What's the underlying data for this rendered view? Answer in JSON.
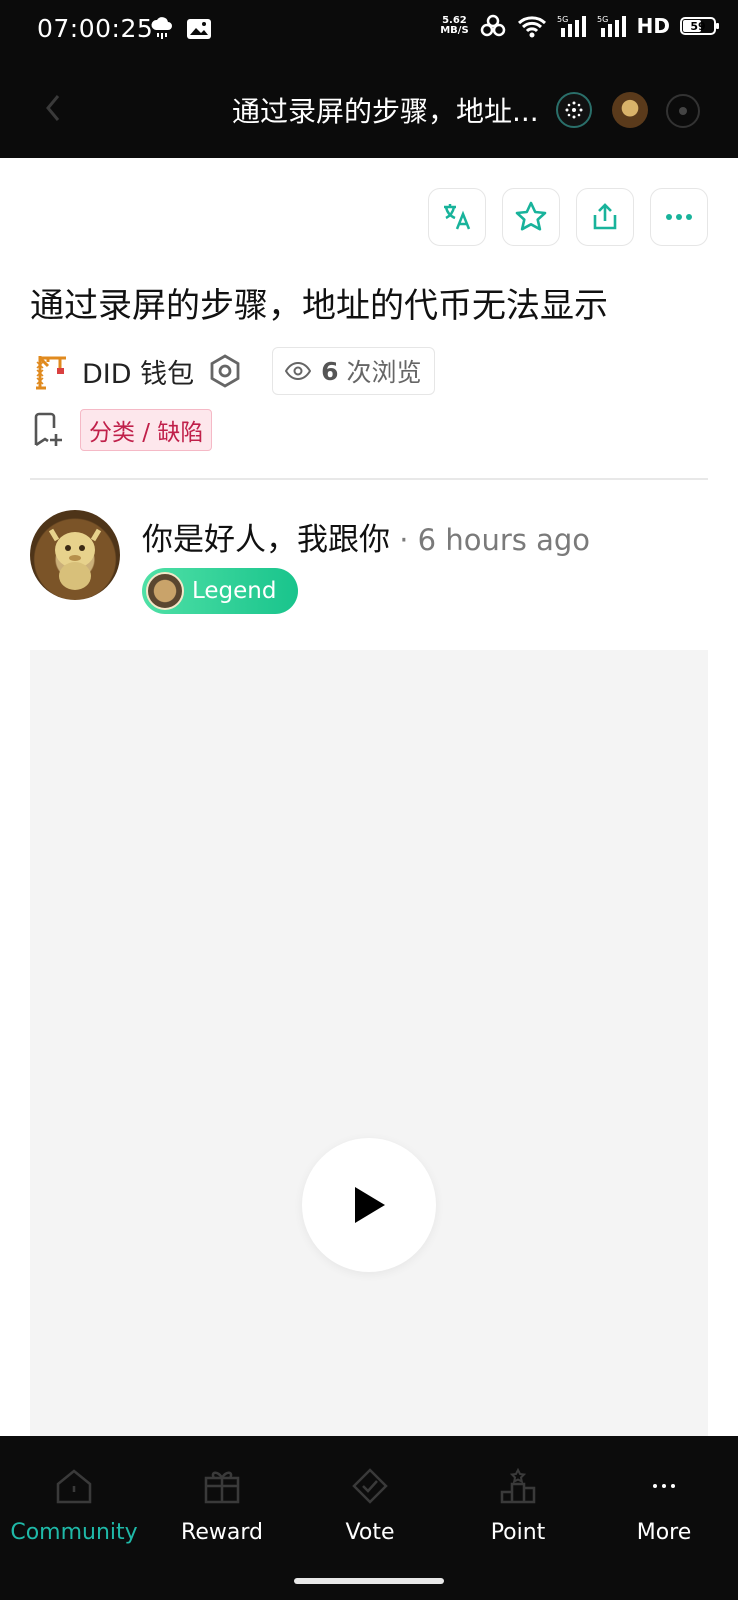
{
  "status_bar": {
    "time": "07:00:25",
    "net_speed_value": "5.62",
    "net_speed_unit": "MB/S",
    "network_label": "HD",
    "battery": "59"
  },
  "top_bar": {
    "title": "通过录屏的步骤，地址..."
  },
  "actions": {
    "translate_icon": "translate-icon",
    "favorite_icon": "star-icon",
    "share_icon": "share-icon",
    "more_icon": "more-icon"
  },
  "post": {
    "title": "通过录屏的步骤，地址的代币无法显示",
    "forum": "DID 钱包",
    "views_count": "6",
    "views_label": "次浏览",
    "tag": "分类 / 缺陷"
  },
  "author": {
    "name": "你是好人，我跟你",
    "separator": " · ",
    "time": "6 hours ago",
    "badge": "Legend"
  },
  "bottom_nav": {
    "items": [
      {
        "label": "Community"
      },
      {
        "label": "Reward"
      },
      {
        "label": "Vote"
      },
      {
        "label": "Point"
      },
      {
        "label": "More"
      }
    ],
    "active_color": "#1fb9a8"
  }
}
